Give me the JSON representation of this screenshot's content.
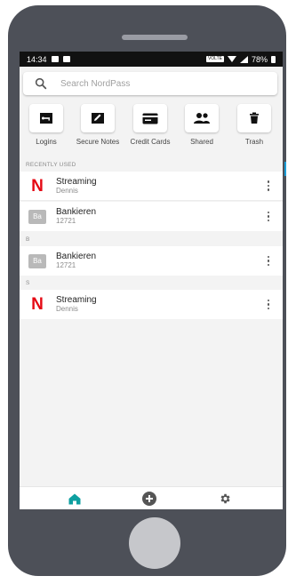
{
  "status_bar": {
    "time": "14:34",
    "network": "VOLTE",
    "battery": "78%"
  },
  "search": {
    "placeholder": "Search NordPass"
  },
  "categories": [
    {
      "label": "Logins",
      "icon": "key-icon"
    },
    {
      "label": "Secure Notes",
      "icon": "pencil-icon"
    },
    {
      "label": "Credit Cards",
      "icon": "credit-card-icon"
    },
    {
      "label": "Shared",
      "icon": "people-icon"
    },
    {
      "label": "Trash",
      "icon": "trash-icon"
    }
  ],
  "sections": [
    {
      "header": "RECENTLY USED",
      "items": [
        {
          "title": "Streaming",
          "subtitle": "Dennis",
          "logo": "netflix-logo",
          "logo_text": "N"
        },
        {
          "title": "Bankieren",
          "subtitle": "12721",
          "logo": "initials-logo",
          "logo_text": "Ba"
        }
      ]
    },
    {
      "header": "B",
      "items": [
        {
          "title": "Bankieren",
          "subtitle": "12721",
          "logo": "initials-logo",
          "logo_text": "Ba"
        }
      ]
    },
    {
      "header": "S",
      "items": [
        {
          "title": "Streaming",
          "subtitle": "Dennis",
          "logo": "netflix-logo",
          "logo_text": "N"
        }
      ]
    }
  ],
  "bottom_nav": [
    {
      "icon": "home-icon",
      "active": true
    },
    {
      "icon": "add-icon",
      "active": false
    },
    {
      "icon": "settings-icon",
      "active": false
    }
  ],
  "colors": {
    "accent": "#0e9fa0",
    "netflix_red": "#e50914",
    "phone_frame": "#4d5058"
  }
}
